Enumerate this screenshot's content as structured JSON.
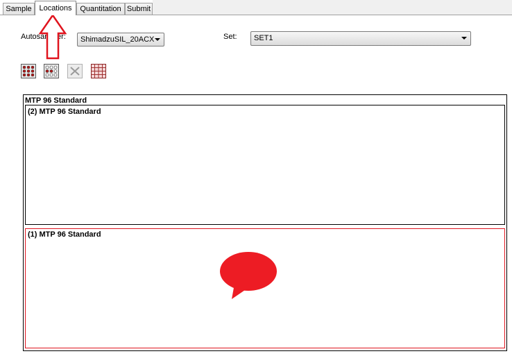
{
  "tabs": [
    {
      "label": "Sample"
    },
    {
      "label": "Locations"
    },
    {
      "label": "Quantitation"
    },
    {
      "label": "Submit"
    }
  ],
  "autosampler": {
    "label": "Autosampler:",
    "value": "ShimadzuSIL_20ACX"
  },
  "set": {
    "label": "Set:",
    "value": "SET1"
  },
  "toolbar": {
    "tools": [
      "plate-select-all-icon",
      "plate-select-icon",
      "clear-icon",
      "grid-icon"
    ]
  },
  "container": {
    "title": "MTP 96 Standard",
    "plates": [
      {
        "label": "(2) MTP 96 Standard"
      },
      {
        "label": "(1) MTP 96 Standard"
      }
    ]
  },
  "colors": {
    "accent": "#e0141e",
    "speech_bubble": "#ed1c24"
  }
}
